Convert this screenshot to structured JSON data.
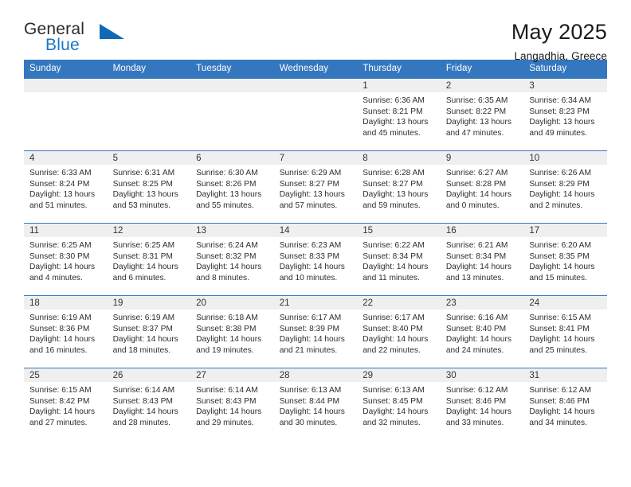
{
  "brand": {
    "name_top": "General",
    "name_bottom": "Blue",
    "triangle_color": "#1069b4",
    "blue_color": "#1878c4"
  },
  "header": {
    "title": "May 2025",
    "subtitle": "Langadhia, Greece"
  },
  "theme": {
    "header_bar": "#3577bf",
    "date_band": "#efefef",
    "grid_line": "#3577bf"
  },
  "weekdays": [
    "Sunday",
    "Monday",
    "Tuesday",
    "Wednesday",
    "Thursday",
    "Friday",
    "Saturday"
  ],
  "weeks": [
    [
      {
        "day": "",
        "empty": true
      },
      {
        "day": "",
        "empty": true
      },
      {
        "day": "",
        "empty": true
      },
      {
        "day": "",
        "empty": true
      },
      {
        "day": "1",
        "sunrise": "Sunrise: 6:36 AM",
        "sunset": "Sunset: 8:21 PM",
        "daylight1": "Daylight: 13 hours",
        "daylight2": "and 45 minutes."
      },
      {
        "day": "2",
        "sunrise": "Sunrise: 6:35 AM",
        "sunset": "Sunset: 8:22 PM",
        "daylight1": "Daylight: 13 hours",
        "daylight2": "and 47 minutes."
      },
      {
        "day": "3",
        "sunrise": "Sunrise: 6:34 AM",
        "sunset": "Sunset: 8:23 PM",
        "daylight1": "Daylight: 13 hours",
        "daylight2": "and 49 minutes."
      }
    ],
    [
      {
        "day": "4",
        "sunrise": "Sunrise: 6:33 AM",
        "sunset": "Sunset: 8:24 PM",
        "daylight1": "Daylight: 13 hours",
        "daylight2": "and 51 minutes."
      },
      {
        "day": "5",
        "sunrise": "Sunrise: 6:31 AM",
        "sunset": "Sunset: 8:25 PM",
        "daylight1": "Daylight: 13 hours",
        "daylight2": "and 53 minutes."
      },
      {
        "day": "6",
        "sunrise": "Sunrise: 6:30 AM",
        "sunset": "Sunset: 8:26 PM",
        "daylight1": "Daylight: 13 hours",
        "daylight2": "and 55 minutes."
      },
      {
        "day": "7",
        "sunrise": "Sunrise: 6:29 AM",
        "sunset": "Sunset: 8:27 PM",
        "daylight1": "Daylight: 13 hours",
        "daylight2": "and 57 minutes."
      },
      {
        "day": "8",
        "sunrise": "Sunrise: 6:28 AM",
        "sunset": "Sunset: 8:27 PM",
        "daylight1": "Daylight: 13 hours",
        "daylight2": "and 59 minutes."
      },
      {
        "day": "9",
        "sunrise": "Sunrise: 6:27 AM",
        "sunset": "Sunset: 8:28 PM",
        "daylight1": "Daylight: 14 hours",
        "daylight2": "and 0 minutes."
      },
      {
        "day": "10",
        "sunrise": "Sunrise: 6:26 AM",
        "sunset": "Sunset: 8:29 PM",
        "daylight1": "Daylight: 14 hours",
        "daylight2": "and 2 minutes."
      }
    ],
    [
      {
        "day": "11",
        "sunrise": "Sunrise: 6:25 AM",
        "sunset": "Sunset: 8:30 PM",
        "daylight1": "Daylight: 14 hours",
        "daylight2": "and 4 minutes."
      },
      {
        "day": "12",
        "sunrise": "Sunrise: 6:25 AM",
        "sunset": "Sunset: 8:31 PM",
        "daylight1": "Daylight: 14 hours",
        "daylight2": "and 6 minutes."
      },
      {
        "day": "13",
        "sunrise": "Sunrise: 6:24 AM",
        "sunset": "Sunset: 8:32 PM",
        "daylight1": "Daylight: 14 hours",
        "daylight2": "and 8 minutes."
      },
      {
        "day": "14",
        "sunrise": "Sunrise: 6:23 AM",
        "sunset": "Sunset: 8:33 PM",
        "daylight1": "Daylight: 14 hours",
        "daylight2": "and 10 minutes."
      },
      {
        "day": "15",
        "sunrise": "Sunrise: 6:22 AM",
        "sunset": "Sunset: 8:34 PM",
        "daylight1": "Daylight: 14 hours",
        "daylight2": "and 11 minutes."
      },
      {
        "day": "16",
        "sunrise": "Sunrise: 6:21 AM",
        "sunset": "Sunset: 8:34 PM",
        "daylight1": "Daylight: 14 hours",
        "daylight2": "and 13 minutes."
      },
      {
        "day": "17",
        "sunrise": "Sunrise: 6:20 AM",
        "sunset": "Sunset: 8:35 PM",
        "daylight1": "Daylight: 14 hours",
        "daylight2": "and 15 minutes."
      }
    ],
    [
      {
        "day": "18",
        "sunrise": "Sunrise: 6:19 AM",
        "sunset": "Sunset: 8:36 PM",
        "daylight1": "Daylight: 14 hours",
        "daylight2": "and 16 minutes."
      },
      {
        "day": "19",
        "sunrise": "Sunrise: 6:19 AM",
        "sunset": "Sunset: 8:37 PM",
        "daylight1": "Daylight: 14 hours",
        "daylight2": "and 18 minutes."
      },
      {
        "day": "20",
        "sunrise": "Sunrise: 6:18 AM",
        "sunset": "Sunset: 8:38 PM",
        "daylight1": "Daylight: 14 hours",
        "daylight2": "and 19 minutes."
      },
      {
        "day": "21",
        "sunrise": "Sunrise: 6:17 AM",
        "sunset": "Sunset: 8:39 PM",
        "daylight1": "Daylight: 14 hours",
        "daylight2": "and 21 minutes."
      },
      {
        "day": "22",
        "sunrise": "Sunrise: 6:17 AM",
        "sunset": "Sunset: 8:40 PM",
        "daylight1": "Daylight: 14 hours",
        "daylight2": "and 22 minutes."
      },
      {
        "day": "23",
        "sunrise": "Sunrise: 6:16 AM",
        "sunset": "Sunset: 8:40 PM",
        "daylight1": "Daylight: 14 hours",
        "daylight2": "and 24 minutes."
      },
      {
        "day": "24",
        "sunrise": "Sunrise: 6:15 AM",
        "sunset": "Sunset: 8:41 PM",
        "daylight1": "Daylight: 14 hours",
        "daylight2": "and 25 minutes."
      }
    ],
    [
      {
        "day": "25",
        "sunrise": "Sunrise: 6:15 AM",
        "sunset": "Sunset: 8:42 PM",
        "daylight1": "Daylight: 14 hours",
        "daylight2": "and 27 minutes."
      },
      {
        "day": "26",
        "sunrise": "Sunrise: 6:14 AM",
        "sunset": "Sunset: 8:43 PM",
        "daylight1": "Daylight: 14 hours",
        "daylight2": "and 28 minutes."
      },
      {
        "day": "27",
        "sunrise": "Sunrise: 6:14 AM",
        "sunset": "Sunset: 8:43 PM",
        "daylight1": "Daylight: 14 hours",
        "daylight2": "and 29 minutes."
      },
      {
        "day": "28",
        "sunrise": "Sunrise: 6:13 AM",
        "sunset": "Sunset: 8:44 PM",
        "daylight1": "Daylight: 14 hours",
        "daylight2": "and 30 minutes."
      },
      {
        "day": "29",
        "sunrise": "Sunrise: 6:13 AM",
        "sunset": "Sunset: 8:45 PM",
        "daylight1": "Daylight: 14 hours",
        "daylight2": "and 32 minutes."
      },
      {
        "day": "30",
        "sunrise": "Sunrise: 6:12 AM",
        "sunset": "Sunset: 8:46 PM",
        "daylight1": "Daylight: 14 hours",
        "daylight2": "and 33 minutes."
      },
      {
        "day": "31",
        "sunrise": "Sunrise: 6:12 AM",
        "sunset": "Sunset: 8:46 PM",
        "daylight1": "Daylight: 14 hours",
        "daylight2": "and 34 minutes."
      }
    ]
  ]
}
